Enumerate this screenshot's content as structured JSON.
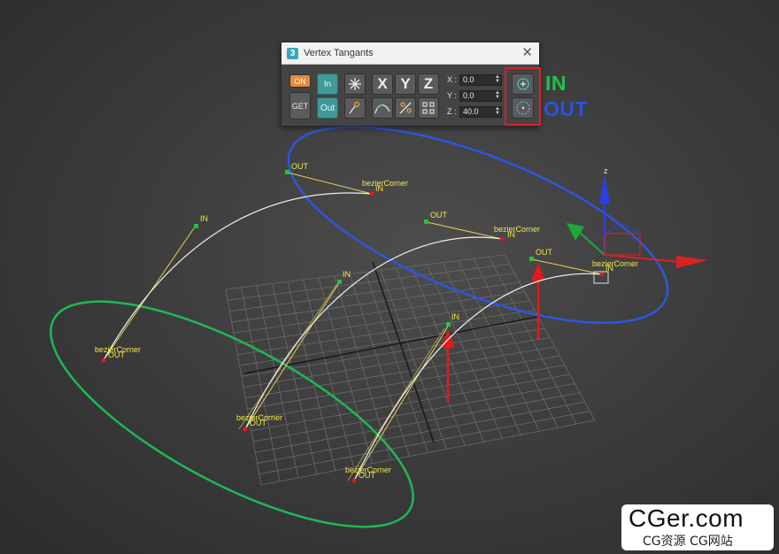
{
  "dialog": {
    "title": "Vertex Tangants",
    "app_icon": "3",
    "close": "✕",
    "on_label": "ON",
    "get_label": "GET",
    "in_label": "In",
    "out_label": "Out",
    "x_letter": "X",
    "y_letter": "Y",
    "z_letter": "Z",
    "fields": [
      {
        "label": "X :",
        "value": "0.0"
      },
      {
        "label": "Y :",
        "value": "0.0"
      },
      {
        "label": "Z :",
        "value": "40.0"
      }
    ],
    "icons": [
      "explode-icon",
      "pick-icon",
      "smooth-curve-icon",
      "tangent-link-icon",
      "tangent-split-icon",
      "in-tangent-icon",
      "out-tangent-icon"
    ]
  },
  "annotations": {
    "in": "IN",
    "out": "OUT",
    "in_color": "#1fc24b",
    "out_color": "#2a52e6",
    "highlight_color": "#d9202a"
  },
  "viewport": {
    "vertex_label": "bezierCorner",
    "in_label": "IN",
    "out_label": "OUT",
    "axis_z": "z",
    "curve_color": "#ffffff",
    "handle_color": "#f2d24a",
    "in_ellipse_color": "#1db954",
    "out_ellipse_color": "#2f55e0"
  },
  "watermark": {
    "logo": "CGer.com",
    "subtitle": "CG资源 CG网站"
  }
}
